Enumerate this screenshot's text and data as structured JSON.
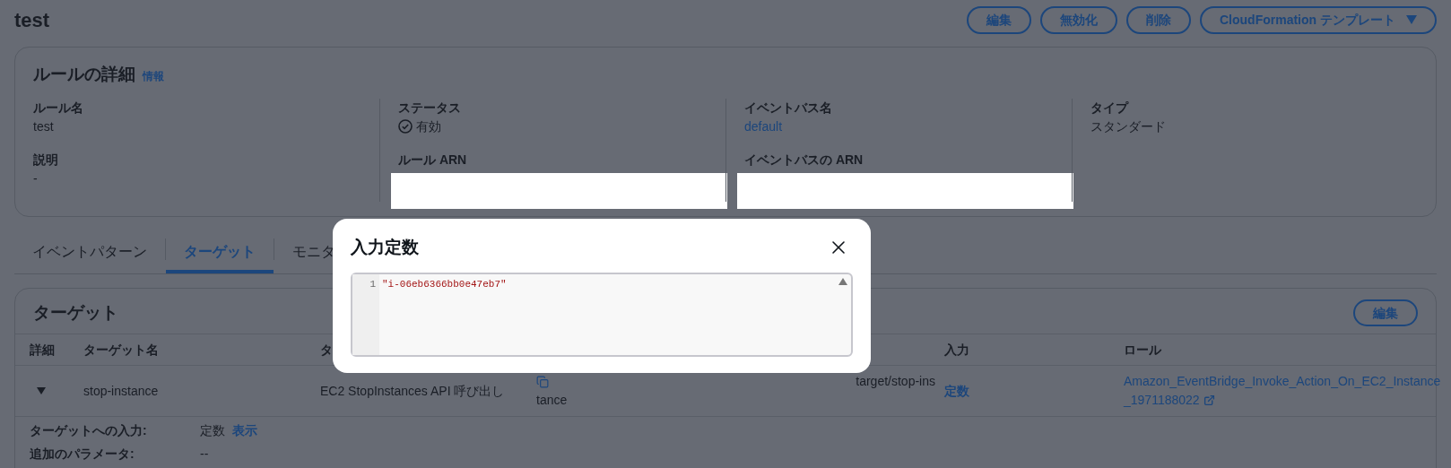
{
  "page": {
    "title": "test",
    "actions": [
      {
        "label": "編集",
        "kind": "button"
      },
      {
        "label": "無効化",
        "kind": "button"
      },
      {
        "label": "削除",
        "kind": "button"
      },
      {
        "label": "CloudFormation テンプレート",
        "kind": "dropdown"
      }
    ]
  },
  "rule_details": {
    "title": "ルールの詳細",
    "info_link": "情報",
    "columns": [
      {
        "items": [
          {
            "label": "ルール名",
            "kind": "text",
            "value": "test"
          },
          {
            "label": "説明",
            "kind": "text",
            "value": "-"
          }
        ]
      },
      {
        "items": [
          {
            "label": "ステータス",
            "kind": "status",
            "value": "有効"
          },
          {
            "label": "ルール ARN",
            "kind": "redacted"
          }
        ]
      },
      {
        "items": [
          {
            "label": "イベントバス名",
            "kind": "link",
            "value": "default"
          },
          {
            "label": "イベントバスの ARN",
            "kind": "redacted"
          }
        ]
      },
      {
        "items": [
          {
            "label": "タイプ",
            "kind": "text",
            "value": "スタンダード"
          }
        ]
      }
    ]
  },
  "tabs": [
    {
      "label": "イベントパターン",
      "selected": false
    },
    {
      "label": "ターゲット",
      "selected": true
    },
    {
      "label": "モニタ",
      "selected": false
    }
  ],
  "targets": {
    "title": "ターゲット",
    "edit_button": "編集",
    "columns": [
      "詳細",
      "ターゲット名",
      "タ",
      "入力",
      "ロール"
    ],
    "rows": [
      {
        "expanded": true,
        "name": "stop-instance",
        "type": "EC2 StopInstances API 呼び出し",
        "arn_lines": [
          "target/stop-ins",
          "tance"
        ],
        "input": "定数",
        "role_lines": [
          "Amazon_EventBridge_Invoke_Action_On_EC2_Instance",
          "_1971188022"
        ]
      }
    ],
    "details": [
      {
        "label": "ターゲットへの入力:",
        "value": "定数",
        "link": "表示"
      },
      {
        "label": "追加のパラメータ:",
        "value": "--"
      }
    ]
  },
  "modal": {
    "title": "入力定数",
    "lines": [
      {
        "number": "1",
        "code": "\"i-06eb6366bb0e47eb7\""
      }
    ]
  }
}
